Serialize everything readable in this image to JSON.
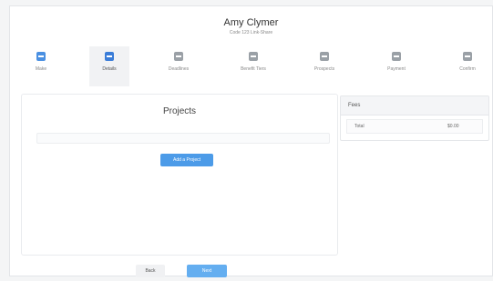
{
  "header": {
    "title": "Amy Clymer",
    "subtitle": "Code 123 Link-Share"
  },
  "steps": [
    {
      "label": "Make",
      "state": "done"
    },
    {
      "label": "Details",
      "state": "active"
    },
    {
      "label": "Deadlines",
      "state": "todo"
    },
    {
      "label": "Benefit Tiers",
      "state": "todo"
    },
    {
      "label": "Prospects",
      "state": "todo"
    },
    {
      "label": "Payment",
      "state": "todo"
    },
    {
      "label": "Confirm",
      "state": "todo"
    }
  ],
  "projects": {
    "title": "Projects",
    "add_button": "Add a Project"
  },
  "fees": {
    "header": "Fees",
    "row_label": "Total",
    "row_amount": "$0.00"
  },
  "footer": {
    "back_label": "Back",
    "next_label": "Next"
  },
  "colors": {
    "accent": "#4c9be8",
    "active_step": "#3b7dd8",
    "inactive_step": "#9aa0a6"
  }
}
